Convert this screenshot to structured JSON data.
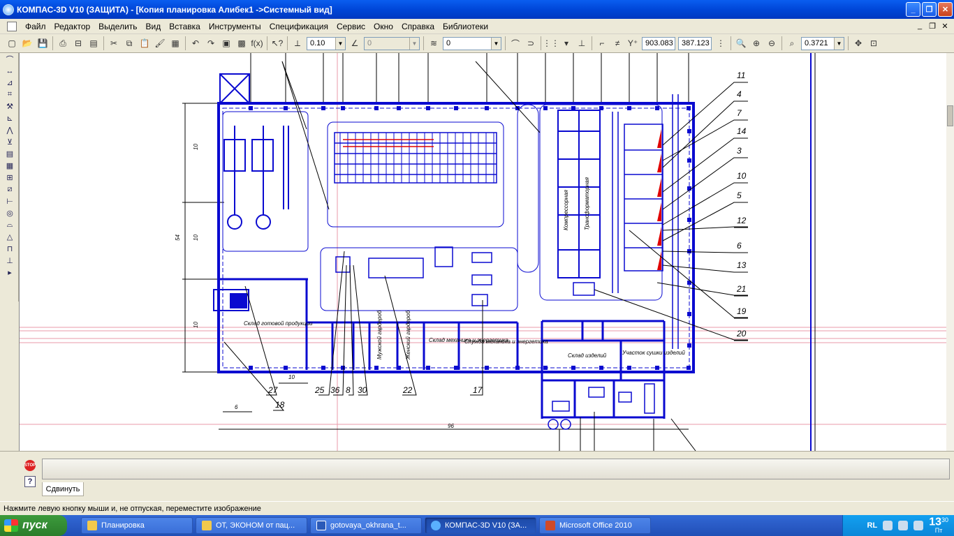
{
  "window": {
    "title": "КОМПАС-3D V10 (ЗАЩИТА) - [Копия планировка Алибек1 ->Системный вид]",
    "controls": [
      "_",
      "❐",
      "✕"
    ]
  },
  "menu": {
    "items": [
      "Файл",
      "Редактор",
      "Выделить",
      "Вид",
      "Вставка",
      "Инструменты",
      "Спецификация",
      "Сервис",
      "Окно",
      "Справка",
      "Библиотеки"
    ],
    "doc_controls": [
      "_",
      "❐",
      "✕"
    ]
  },
  "toolbar": {
    "step": "0.10",
    "angle": "0",
    "layer": "0",
    "coord_x": "903.083",
    "coord_y": "387.123",
    "zoom": "0.3721",
    "fx_label": "f(x)"
  },
  "drawing": {
    "callouts_right": [
      "11",
      "4",
      "7",
      "14",
      "3",
      "10",
      "5",
      "12",
      "6",
      "13",
      "21",
      "19",
      "20"
    ],
    "callouts_bottom": [
      "25",
      "36",
      "8",
      "30",
      "22",
      "17"
    ],
    "callouts_left": [
      "27",
      "18"
    ],
    "dims": [
      "10",
      "10",
      "10",
      "54",
      "10",
      "6",
      "96"
    ],
    "room_labels": {
      "finished_goods": "Склад готовой продукции",
      "male_room": "Мужской гардероб",
      "female_room": "Женский гардероб",
      "warehouse_mech": "Склад механика и энергетика",
      "service_mech": "Служба механика и энергетика",
      "parts_store": "Склад изделий",
      "drying": "Участок сушки изделий",
      "compressor": "Компрессорная",
      "transformer": "Трансформаторная"
    }
  },
  "command": {
    "stop_label": "STOP",
    "help_label": "?",
    "tab": "Сдвинуть"
  },
  "status": {
    "text": "Нажмите левую кнопку мыши и, не отпуская, переместите изображение"
  },
  "taskbar": {
    "start": "пуск",
    "tasks": [
      "Планировка",
      "ОТ, ЭКОНОМ от пац...",
      "gotovaya_okhrana_t...",
      "КОМПАС-3D V10 (ЗА...",
      "Microsoft Office 2010"
    ],
    "active_index": 3,
    "lang": "RL",
    "time": "13",
    "time_min": "30",
    "day": "Пт"
  }
}
